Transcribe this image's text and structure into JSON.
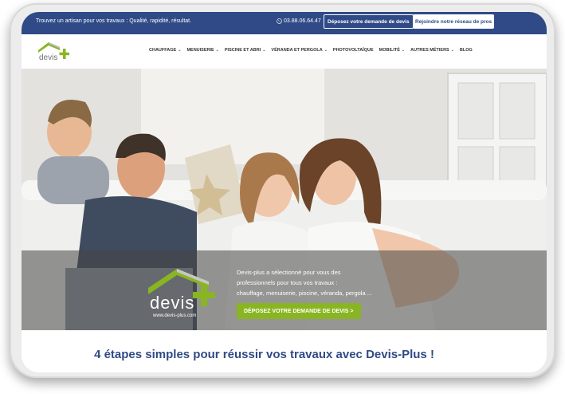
{
  "topbar": {
    "tagline": "Trouvez un artisan pour vos travaux : Qualité, rapidité, résultat.",
    "phone": "03.88.06.64.47",
    "deposit_button": "Déposez votre demande de devis",
    "join_button": "Rejoindre notre réseau de pros"
  },
  "logo": {
    "text": "devis",
    "plus": "+",
    "url": "www.devis-plus.com"
  },
  "nav": {
    "items": [
      {
        "label": "CHAUFFAGE",
        "dropdown": true
      },
      {
        "label": "MENUISERIE",
        "dropdown": true
      },
      {
        "label": "PISCINE ET ABRI",
        "dropdown": true
      },
      {
        "label": "VÉRANDA ET PERGOLA",
        "dropdown": true
      },
      {
        "label": "PHOTOVOLTAÏQUE",
        "dropdown": false
      },
      {
        "label": "MOBILITÉ",
        "dropdown": true
      },
      {
        "label": "AUTRES MÉTIERS",
        "dropdown": true
      },
      {
        "label": "BLOG",
        "dropdown": false
      }
    ],
    "chevron": "⌄"
  },
  "hero": {
    "text_line1": "Devis-plus a sélectionné pour vous des",
    "text_line2": "professionnels pour tous vos travaux :",
    "text_line3": "chauffage, menuiserie, piscine, véranda, pergola ...",
    "cta": "DÉPOSEZ VOTRE DEMANDE DE DEVIS >"
  },
  "section": {
    "title": "4 étapes simples pour réussir vos travaux avec Devis-Plus !"
  },
  "colors": {
    "brand_blue": "#2f4a86",
    "brand_green": "#8ab523",
    "logo_grey": "#7a7a7a"
  }
}
